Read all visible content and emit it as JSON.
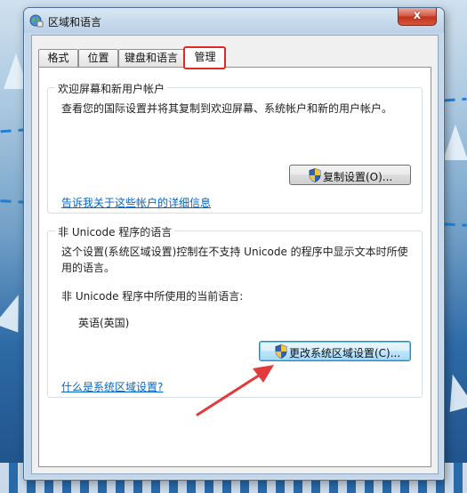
{
  "window": {
    "title": "区域和语言",
    "close_glyph": "x"
  },
  "tabs": [
    {
      "label": "格式",
      "active": false
    },
    {
      "label": "位置",
      "active": false
    },
    {
      "label": "键盘和语言",
      "active": false
    },
    {
      "label": "管理",
      "active": true
    }
  ],
  "welcome_group": {
    "title": "欢迎屏幕和新用户帐户",
    "description": "查看您的国际设置并将其复制到欢迎屏幕、系统帐户和新的用户帐户。",
    "copy_button": "复制设置(O)...",
    "link": "告诉我关于这些帐户的详细信息"
  },
  "unicode_group": {
    "title": "非 Unicode 程序的语言",
    "description_line1": "这个设置(系统区域设置)控制在不支持 Unicode 的程序中显示文本时所使",
    "description_line2": "用的语言。",
    "current_label": "非 Unicode 程序中所使用的当前语言:",
    "current_value": "英语(英国)",
    "change_button": "更改系统区域设置(C)...",
    "link": "什么是系统区域设置?"
  },
  "colors": {
    "link": "#0066cc",
    "highlight_box": "#e02a2a",
    "annotation_arrow": "#e23b3b"
  },
  "icons": [
    "globe-icon",
    "close-icon",
    "uac-shield-icon",
    "annotation-arrow"
  ]
}
